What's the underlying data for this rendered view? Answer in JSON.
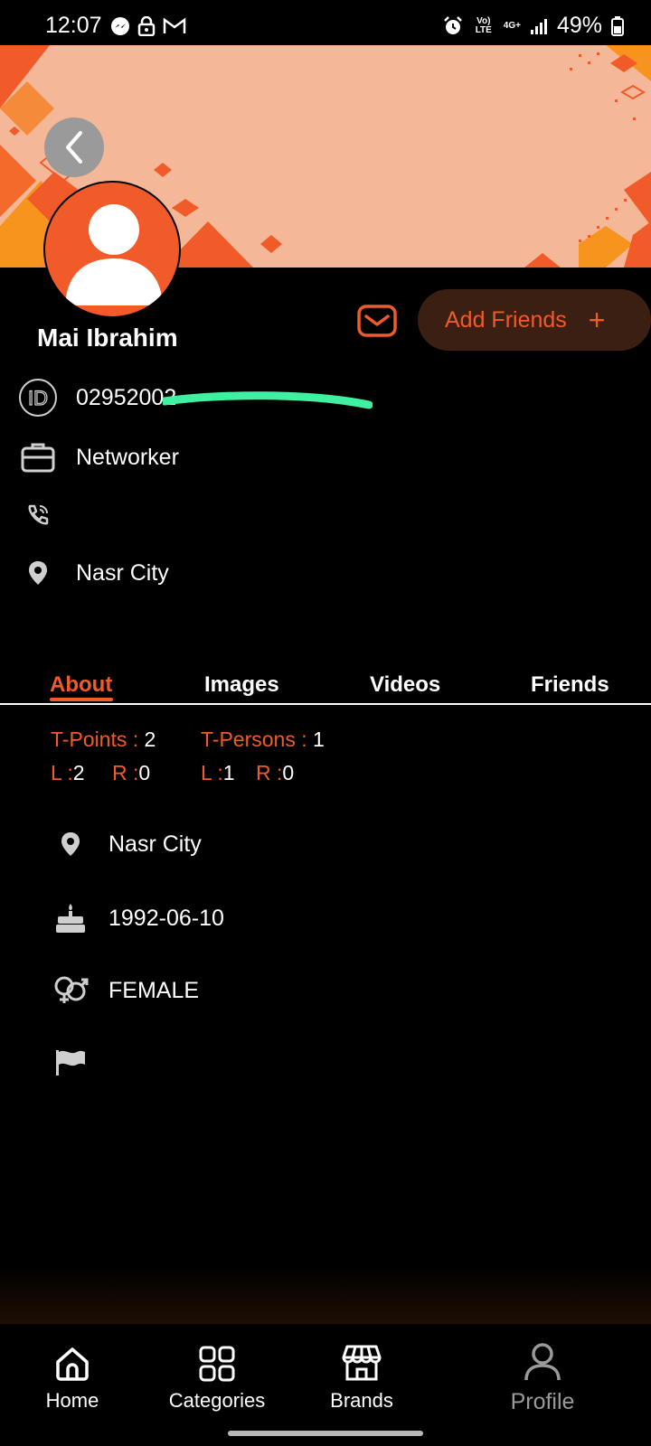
{
  "status_bar": {
    "time": "12:07",
    "battery": "49%",
    "volte": "Vo) LTE",
    "network": "4G+"
  },
  "profile": {
    "name": "Mai Ibrahim",
    "id": "02952002",
    "job": "Networker",
    "phone": "",
    "location": "Nasr City"
  },
  "actions": {
    "add_friends_label": "Add Friends",
    "add_icon": "+"
  },
  "tabs": [
    {
      "label": "About",
      "active": true
    },
    {
      "label": "Images",
      "active": false
    },
    {
      "label": "Videos",
      "active": false
    },
    {
      "label": "Friends",
      "active": false
    }
  ],
  "stats": {
    "t_points_label": "T-Points :",
    "t_points_value": "2",
    "t_persons_label": "T-Persons :",
    "t_persons_value": "1",
    "left1_label": "L :",
    "left1_value": "2",
    "right1_label": "R :",
    "right1_value": "0",
    "left2_label": "L :",
    "left2_value": "1",
    "right2_label": "R :",
    "right2_value": "0"
  },
  "about": {
    "location": "Nasr City",
    "birthdate": "1992-06-10",
    "gender": "FEMALE",
    "country": ""
  },
  "bottom_nav": [
    {
      "label": "Home"
    },
    {
      "label": "Categories"
    },
    {
      "label": "Brands"
    },
    {
      "label": "Profile"
    }
  ],
  "colors": {
    "accent": "#f15a29",
    "cover": "#f4b898",
    "background": "#000000",
    "muted": "#9a9a9a"
  }
}
